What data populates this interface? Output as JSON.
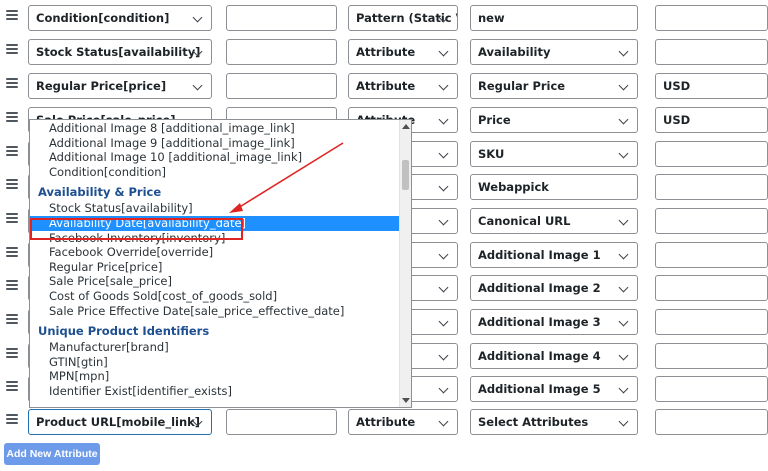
{
  "rows": [
    {
      "attr": "Condition[condition]",
      "prefix": "",
      "type": "Pattern (Static Va",
      "value": "new",
      "suffix": ""
    },
    {
      "attr": "Stock Status[availability]",
      "prefix": "",
      "type": "Attribute",
      "value": "Availability",
      "suffix": ""
    },
    {
      "attr": "Regular Price[price]",
      "prefix": "",
      "type": "Attribute",
      "value": "Regular Price",
      "suffix": "USD"
    },
    {
      "attr": "Sale Price[sale_price]",
      "prefix": "",
      "type": "Attribute",
      "value": "Price",
      "suffix": "USD"
    },
    {
      "attr": "",
      "prefix": "",
      "type": "",
      "value": "SKU",
      "suffix": ""
    },
    {
      "attr": "",
      "prefix": "",
      "type": "atic Va",
      "value": "Webappick",
      "suffix": ""
    },
    {
      "attr": "",
      "prefix": "",
      "type": "",
      "value": "Canonical URL",
      "suffix": ""
    },
    {
      "attr": "",
      "prefix": "",
      "type": "",
      "value": "Additional Image 1",
      "suffix": ""
    },
    {
      "attr": "",
      "prefix": "",
      "type": "",
      "value": "Additional Image 2",
      "suffix": ""
    },
    {
      "attr": "",
      "prefix": "",
      "type": "",
      "value": "Additional Image 3",
      "suffix": ""
    },
    {
      "attr": "",
      "prefix": "",
      "type": "",
      "value": "Additional Image 4",
      "suffix": ""
    },
    {
      "attr": "",
      "prefix": "",
      "type": "",
      "value": "Additional Image 5",
      "suffix": ""
    },
    {
      "attr": "Product URL[mobile_link]",
      "prefix": "",
      "type": "Attribute",
      "value": "Select Attributes",
      "suffix": ""
    }
  ],
  "dropdown": {
    "items_before": [
      "Additional Image 8 [additional_image_link]",
      "Additional Image 9 [additional_image_link]",
      "Additional Image 10 [additional_image_link]",
      "Condition[condition]"
    ],
    "group1": "Availability & Price",
    "group1_items": [
      "Stock Status[availability]",
      "Availability Date[availability_date]",
      "Facebook Inventory[inventory]",
      "Facebook Override[override]",
      "Regular Price[price]",
      "Sale Price[sale_price]",
      "Cost of Goods Sold[cost_of_goods_sold]",
      "Sale Price Effective Date[sale_price_effective_date]"
    ],
    "group2": "Unique Product Identifiers",
    "group2_items": [
      "Manufacturer[brand]",
      "GTIN[gtin]",
      "MPN[mpn]",
      "Identifier Exist[identifier_exists]"
    ],
    "highlighted": "Availability Date[availability_date]"
  },
  "add_button_label": "Add New Attribute",
  "colors": {
    "highlight": "#1e90ff",
    "annotation": "#e02424",
    "button": "#6d9bea",
    "group_heading": "#1d4f91"
  }
}
